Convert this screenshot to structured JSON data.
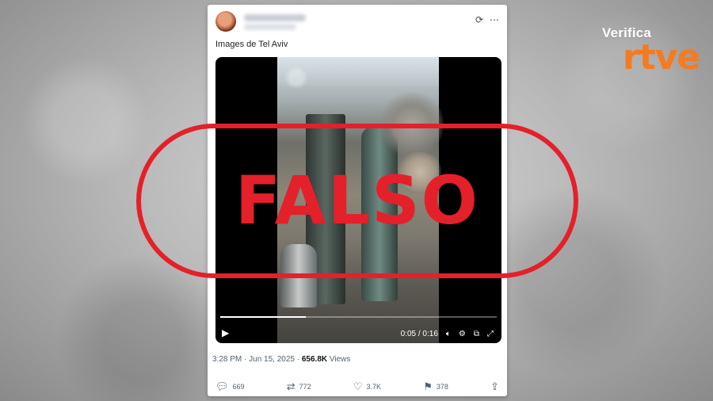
{
  "brand": {
    "top": "Verifica",
    "main": "rtve"
  },
  "post": {
    "caption": "Images de Tel Aviv",
    "video": {
      "elapsed": "0:05",
      "duration": "0:16",
      "time_display": "0:05 / 0:16",
      "progress": 0.31
    },
    "meta": {
      "time": "3:28 PM",
      "date": "Jun 15, 2025",
      "views_count": "656.8K",
      "views_label": "Views"
    },
    "actions": {
      "replies": "669",
      "reposts": "772",
      "likes": "3.7K",
      "bookmarks": "378"
    }
  },
  "stamp": {
    "text": "FALSO"
  },
  "colors": {
    "stamp_red": "#e4202a",
    "brand_orange": "#f47b20"
  }
}
